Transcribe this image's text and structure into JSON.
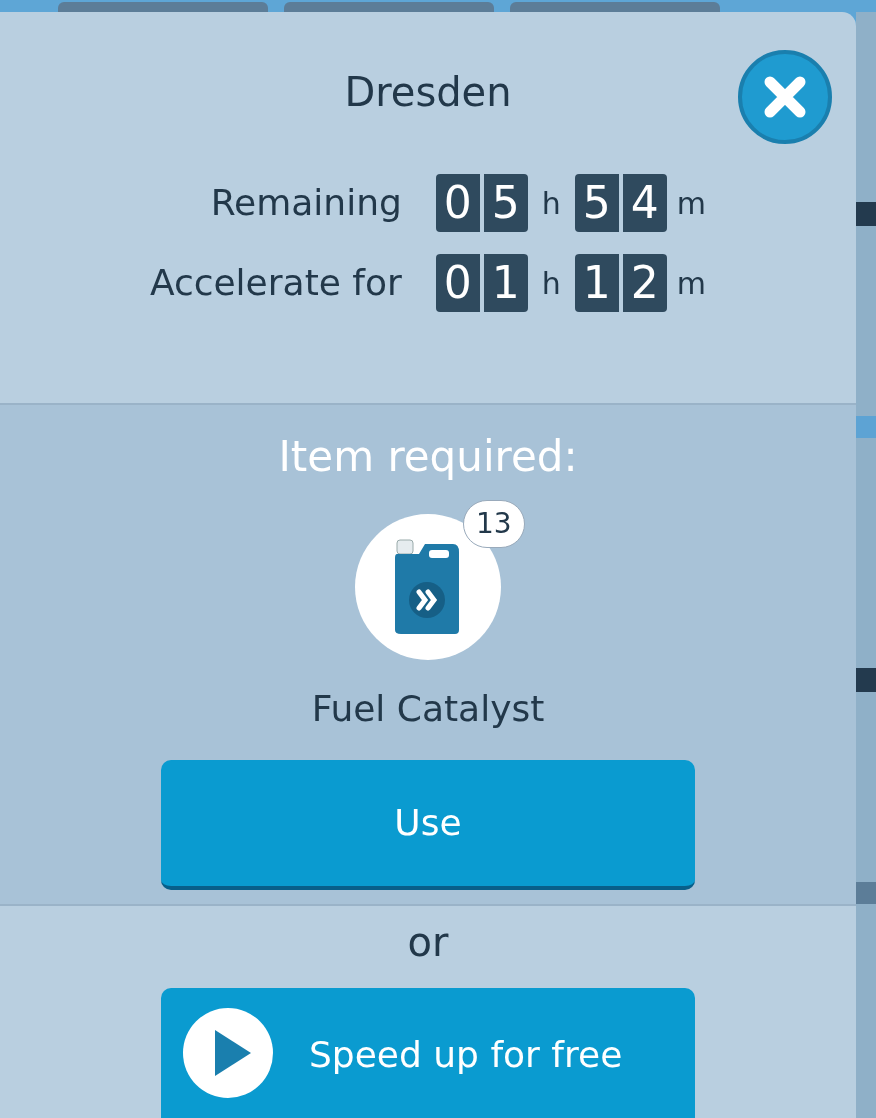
{
  "dialog": {
    "title": "Dresden"
  },
  "timers": [
    {
      "label": "Remaining",
      "hours": "05",
      "hours_unit": "h",
      "minutes": "54",
      "minutes_unit": "m"
    },
    {
      "label": "Accelerate for",
      "hours": "01",
      "hours_unit": "h",
      "minutes": "12",
      "minutes_unit": "m"
    }
  ],
  "item_section": {
    "heading": "Item required:",
    "item": {
      "name": "Fuel Catalyst",
      "count": "13"
    },
    "button": "Use"
  },
  "separator": "or",
  "free_button": "Speed up for free"
}
